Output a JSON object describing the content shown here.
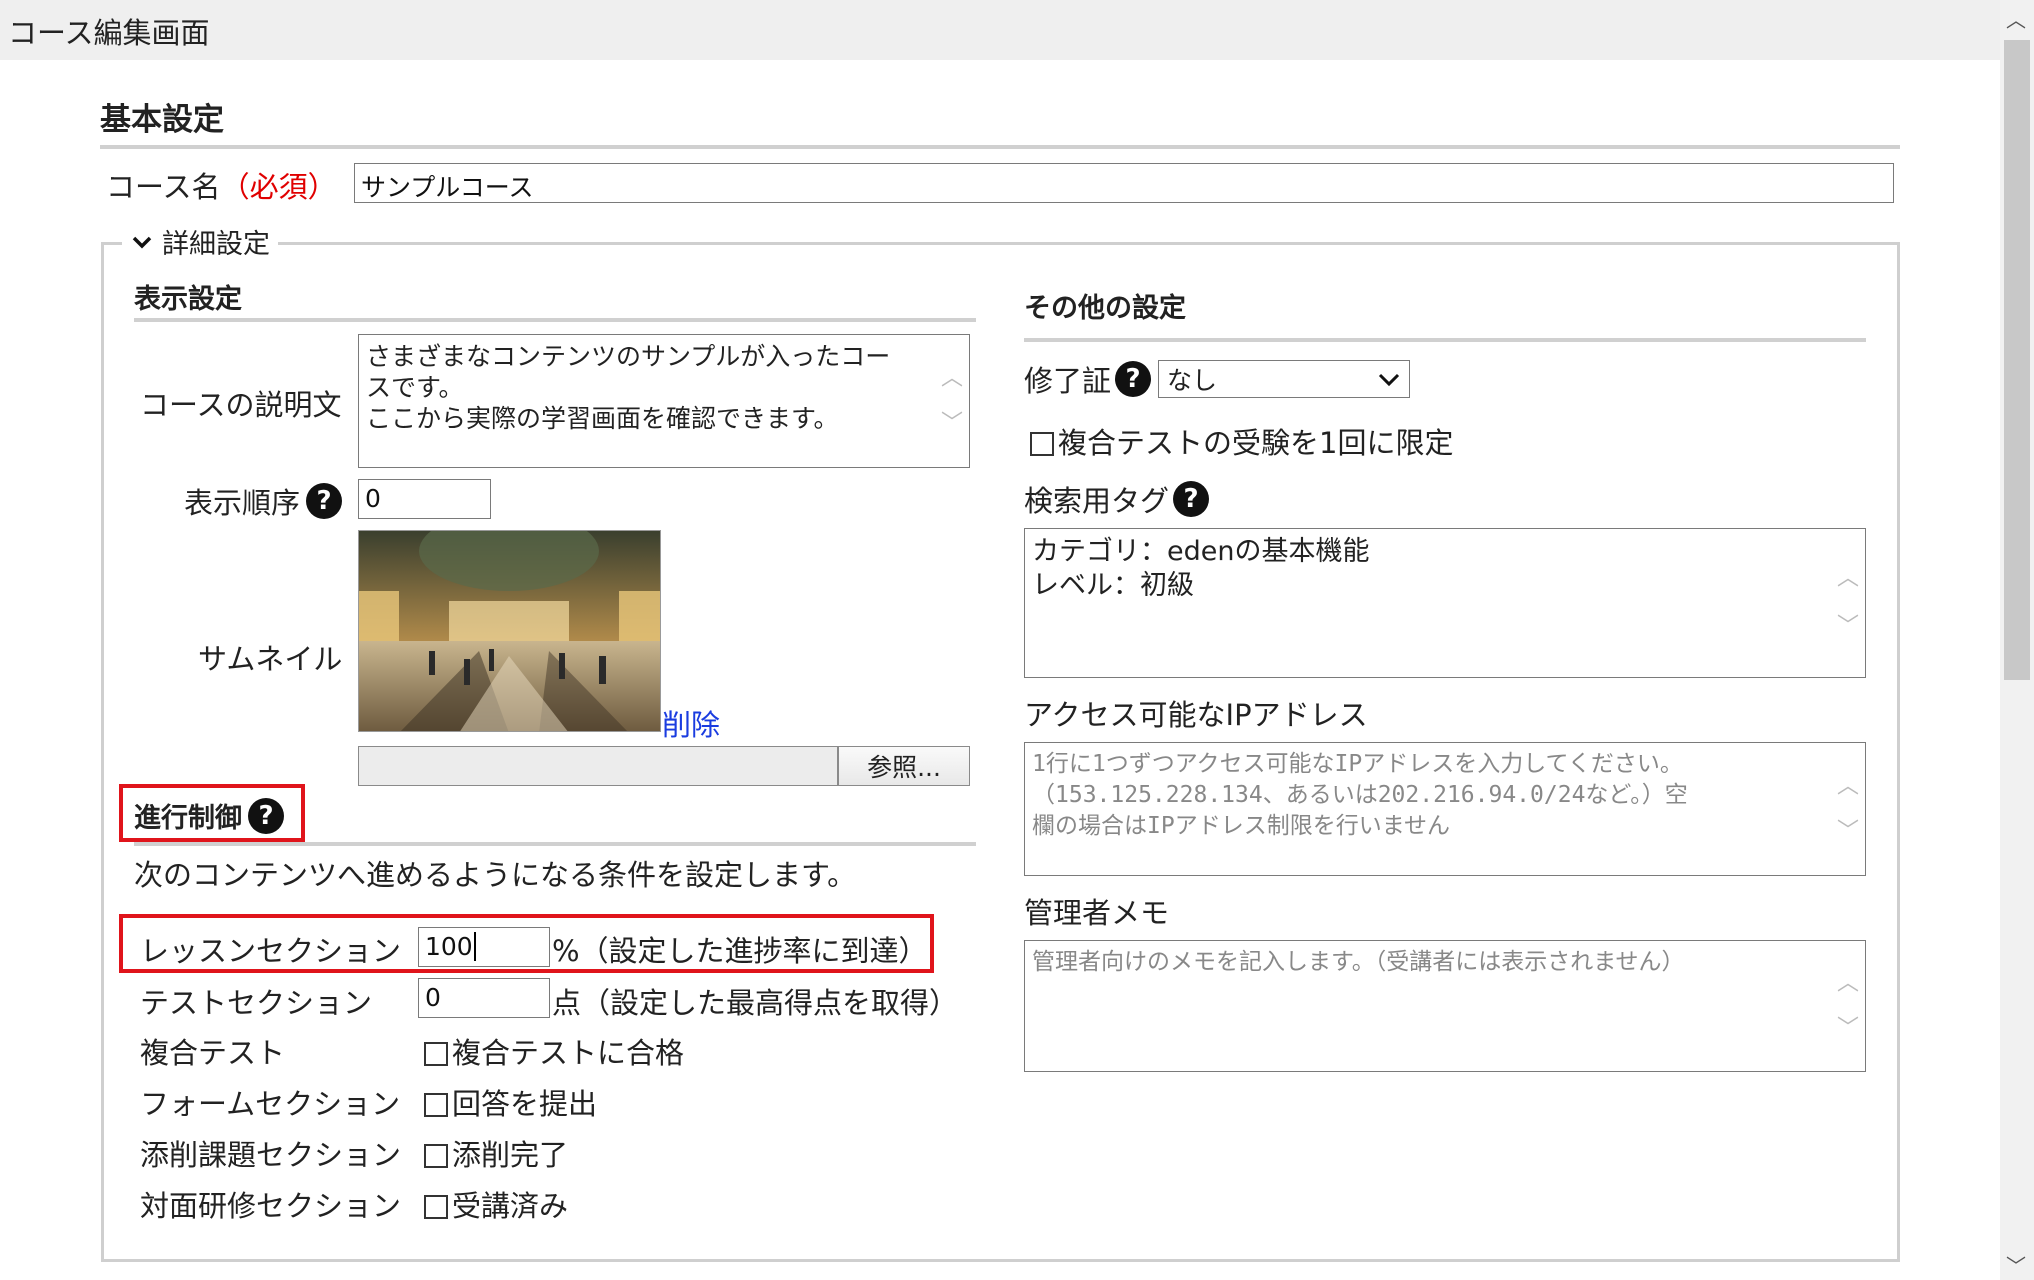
{
  "window": {
    "title": "コース編集画面"
  },
  "basic": {
    "heading": "基本設定",
    "course_name_label": "コース名",
    "required_mark": "（必須）",
    "course_name_value": "サンプルコース"
  },
  "details": {
    "legend": "詳細設定",
    "display": {
      "heading": "表示設定",
      "description_label": "コースの説明文",
      "description_line1": "さまざまなコンテンツのサンプルが入ったコー",
      "description_line2": "スです。",
      "description_line3": "ここから実際の学習画面を確認できます。",
      "order_label": "表示順序",
      "order_value": "0",
      "thumbnail_label": "サムネイル",
      "delete_link": "削除",
      "browse_button": "参照..."
    },
    "progress": {
      "heading": "進行制御",
      "description": "次のコンテンツへ進めるようになる条件を設定します。",
      "lesson_label": "レッスンセクション",
      "lesson_value": "100",
      "lesson_suffix": "%（設定した進捗率に到達）",
      "test_label": "テストセクション",
      "test_value": "0",
      "test_suffix": "点（設定した最高得点を取得）",
      "composite_label": "複合テスト",
      "composite_check": "複合テストに合格",
      "form_label": "フォームセクション",
      "form_check": "回答を提出",
      "correction_label": "添削課題セクション",
      "correction_check": "添削完了",
      "facetoface_label": "対面研修セクション",
      "facetoface_check": "受講済み"
    },
    "other": {
      "heading": "その他の設定",
      "certificate_label": "修了証",
      "certificate_selected": "なし",
      "limit_check": "複合テストの受験を1回に限定",
      "tags_label": "検索用タグ",
      "tags_line1": "カテゴリ：edenの基本機能",
      "tags_line2": "レベル：初級",
      "ip_label": "アクセス可能なIPアドレス",
      "ip_placeholder_line1": "1行に1つずつアクセス可能なIPアドレスを入力してください。",
      "ip_placeholder_line2": "（153.125.228.134、あるいは202.216.94.0/24など。）空",
      "ip_placeholder_line3": "欄の場合はIPアドレス制限を行いません",
      "memo_label": "管理者メモ",
      "memo_placeholder": "管理者向けのメモを記入します。（受講者には表示されません）"
    }
  },
  "icons": {
    "help": "question-circle-icon",
    "chevron": "chevron-down-icon"
  }
}
